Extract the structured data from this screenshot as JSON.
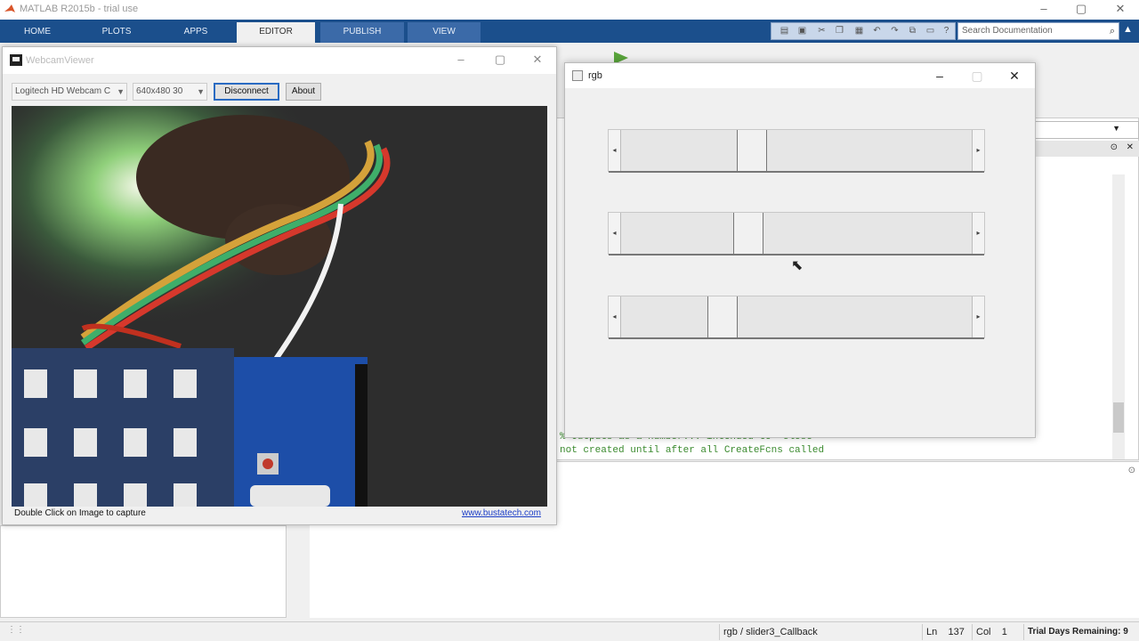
{
  "matlab": {
    "title": "MATLAB R2015b - trial use",
    "tabs": [
      "HOME",
      "PLOTS",
      "APPS",
      "EDITOR",
      "PUBLISH",
      "VIEW"
    ],
    "active_tab": "EDITOR",
    "search_placeholder": "Search Documentation",
    "code_lines": [
      "% Outputs as a number... intended to 'close'",
      "not created until after all CreateFcns called"
    ]
  },
  "status_bar": {
    "callback": "rgb / slider3_Callback",
    "ln_label": "Ln",
    "ln_value": "137",
    "col_label": "Col",
    "col_value": "1",
    "trial": "Trial Days Remaining: 9"
  },
  "webcam_viewer": {
    "title": "WebcamViewer",
    "camera_select": "Logitech HD Webcam C",
    "resolution_select": "640x480 30",
    "disconnect_label": "Disconnect",
    "about_label": "About",
    "footer_hint": "Double Click on Image to capture",
    "footer_link": "www.bustatech.com"
  },
  "rgb_figure": {
    "title": "rgb",
    "sliders": [
      {
        "name": "slider1",
        "value_fraction": 0.36
      },
      {
        "name": "slider2",
        "value_fraction": 0.35
      },
      {
        "name": "slider3",
        "value_fraction": 0.27
      }
    ]
  },
  "colors": {
    "ribbon": "#1b4f8c",
    "link": "#1a3cc6",
    "code_comment": "#3a8a2e"
  }
}
